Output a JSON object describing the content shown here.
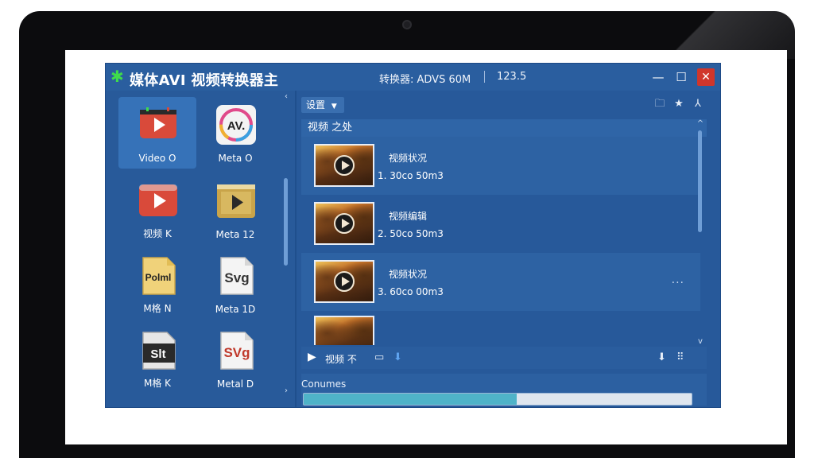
{
  "window": {
    "title": "媒体AVI 视频转换器主",
    "status": "转换器: ADVS 60M",
    "number": "123.5",
    "controls": [
      "minimize-icon",
      "maximize-icon",
      "close-icon"
    ],
    "accent_color": "#27599a",
    "close_color": "#d0362b"
  },
  "formats": [
    {
      "label": "Video O",
      "icon": "video-play-icon",
      "selected": true
    },
    {
      "label": "Meta O",
      "icon": "avi-icon",
      "selected": false
    },
    {
      "label": "视频 K",
      "icon": "youtube-icon",
      "selected": false
    },
    {
      "label": "Meta 12",
      "icon": "media-play-icon",
      "selected": false
    },
    {
      "label": "M格 N",
      "icon": "polmi-file-icon",
      "selected": false
    },
    {
      "label": "Meta 1D",
      "icon": "svg-file-icon",
      "selected": false
    },
    {
      "label": "M格 K",
      "icon": "srt-icon",
      "selected": false
    },
    {
      "label": "Metal D",
      "icon": "svg-red-icon",
      "selected": false
    }
  ],
  "format_icon_text": {
    "avi": "AV.",
    "polmi": "Polml",
    "svg": "Svg",
    "srt": "Slt",
    "svg2": "SVg"
  },
  "toolbar": {
    "dropdown": "设置",
    "icons": [
      "folder-icon",
      "star-icon",
      "pin-icon"
    ]
  },
  "list_header": "视频 之处",
  "files": [
    {
      "title": "视频状况",
      "meta": "1. 30co 50m3"
    },
    {
      "title": "视频编辑",
      "meta": "2. 50co 50m3"
    },
    {
      "title": "视频状况",
      "meta": "3. 60co 00m3"
    }
  ],
  "row_more": "···",
  "bottom_bar": {
    "label": "视频 不"
  },
  "progress": {
    "label": "Conumes",
    "value": 0.55
  }
}
